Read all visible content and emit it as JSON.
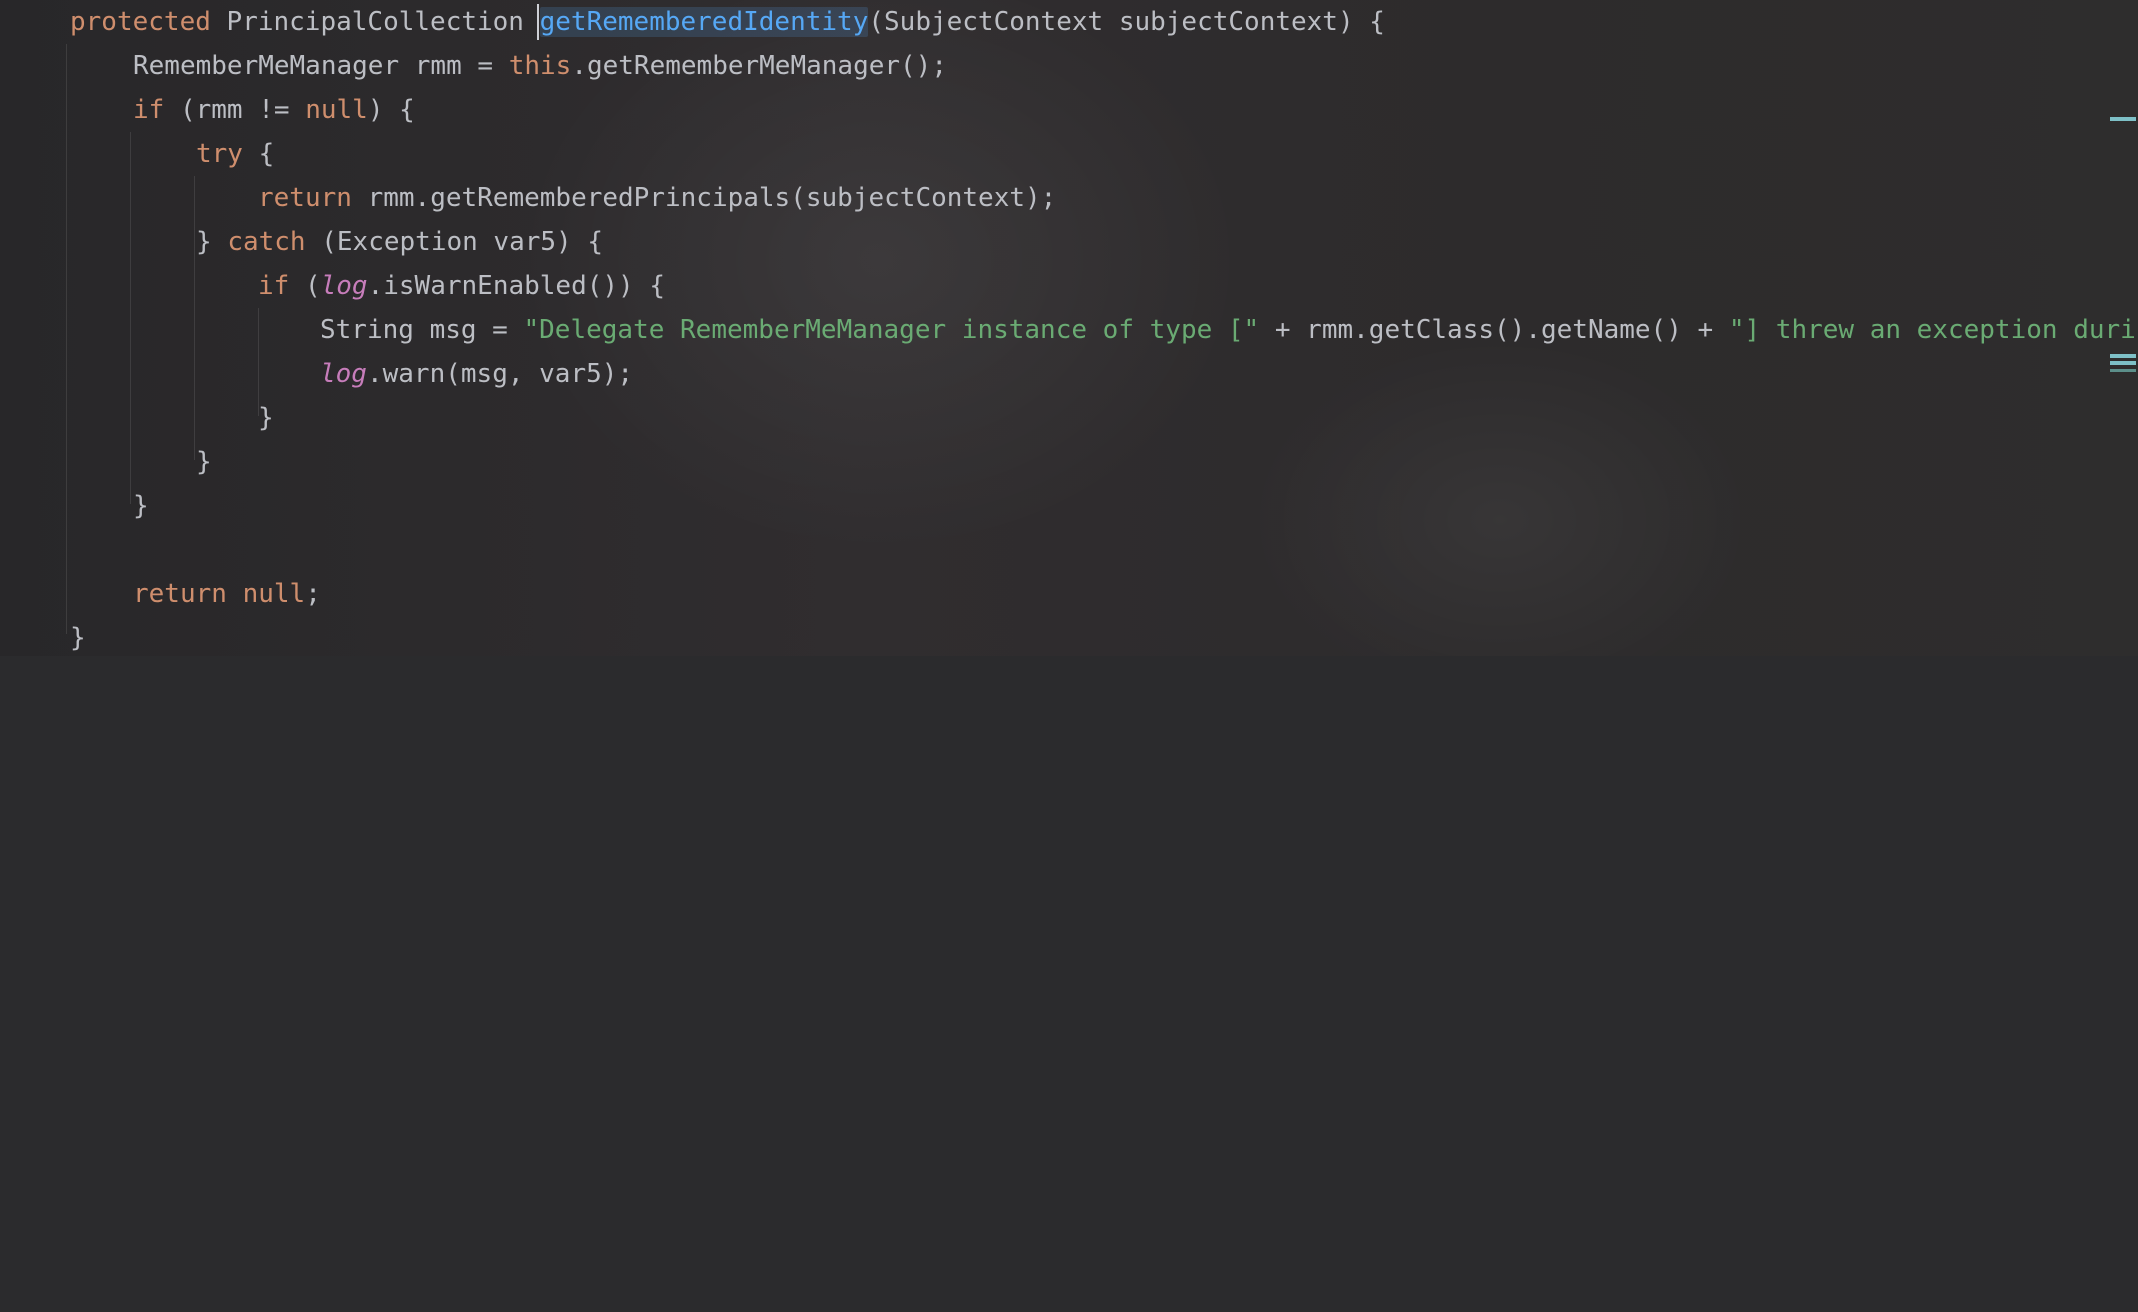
{
  "editor": {
    "line1": {
      "modifier": "protected",
      "return_type": " PrincipalCollection ",
      "method_name": "getRememberedIdentity",
      "params": "(SubjectContext subjectContext) {"
    },
    "line2": {
      "decl": "RememberMeManager rmm = ",
      "this_kw": "this",
      "call": ".getRememberMeManager();"
    },
    "line3": {
      "if_kw": "if",
      "cond": " (rmm != ",
      "null_kw": "null",
      "close": ") {"
    },
    "line4": {
      "try_kw": "try",
      "brace": " {"
    },
    "line5": {
      "return_kw": "return",
      "rest": " rmm.getRememberedPrincipals(subjectContext);"
    },
    "line6": {
      "close": "} ",
      "catch_kw": "catch",
      "rest": " (Exception var5) {"
    },
    "line7": {
      "if_kw": "if",
      "open": " (",
      "log": "log",
      "rest": ".isWarnEnabled()) {"
    },
    "line8": {
      "decl": "String msg = ",
      "str1": "\"Delegate RememberMeManager instance of type [\"",
      "mid": " + rmm.getClass().getName() + ",
      "str2": "\"] threw an exception during"
    },
    "line9": {
      "log": "log",
      "rest": ".warn(msg, var5);"
    },
    "line10": {
      "brace": "}"
    },
    "line11": {
      "brace": "}"
    },
    "line12": {
      "brace": "}"
    },
    "line14": {
      "return_kw": "return",
      "space": " ",
      "null_kw": "null",
      "semi": ";"
    },
    "line15": {
      "brace": "}"
    }
  },
  "colors": {
    "keyword": "#cf8e6d",
    "method_declaration": "#56a8f5",
    "static_field": "#c77dbb",
    "string": "#6aab73",
    "default_text": "#bcbec4",
    "scrollbar_mark": "#7ec0c7"
  }
}
